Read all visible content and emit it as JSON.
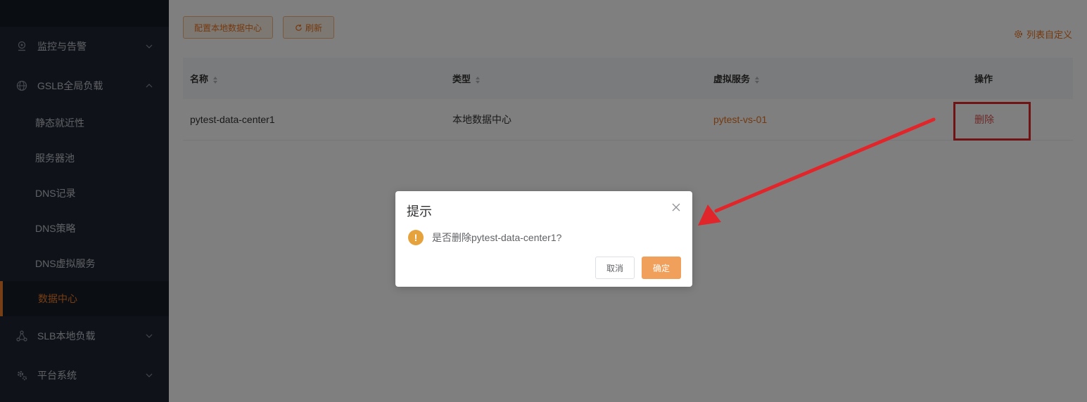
{
  "sidebar": {
    "groups": [
      {
        "label": "监控与告警",
        "icon": "location-pin-icon",
        "expanded": false
      },
      {
        "label": "GSLB全局负载",
        "icon": "globe-icon",
        "expanded": true
      },
      {
        "label": "SLB本地负载",
        "icon": "nodes-icon",
        "expanded": false
      },
      {
        "label": "平台系统",
        "icon": "gears-icon",
        "expanded": false
      }
    ],
    "gslb_items": [
      "静态就近性",
      "服务器池",
      "DNS记录",
      "DNS策略",
      "DNS虚拟服务",
      "数据中心"
    ],
    "active_item": "数据中心"
  },
  "toolbar": {
    "config_label": "配置本地数据中心",
    "refresh_label": "刷新",
    "column_custom_label": "列表自定义"
  },
  "table": {
    "headers": [
      "名称",
      "类型",
      "虚拟服务",
      "操作"
    ],
    "rows": [
      {
        "name": "pytest-data-center1",
        "type": "本地数据中心",
        "virtual_service": "pytest-vs-01",
        "action": "删除"
      }
    ]
  },
  "dialog": {
    "title": "提示",
    "message": "是否删除pytest-data-center1?",
    "cancel_label": "取消",
    "ok_label": "确定"
  },
  "colors": {
    "accent": "#e8731e",
    "annotation": "#e0262b",
    "warning": "#e6a23c"
  }
}
